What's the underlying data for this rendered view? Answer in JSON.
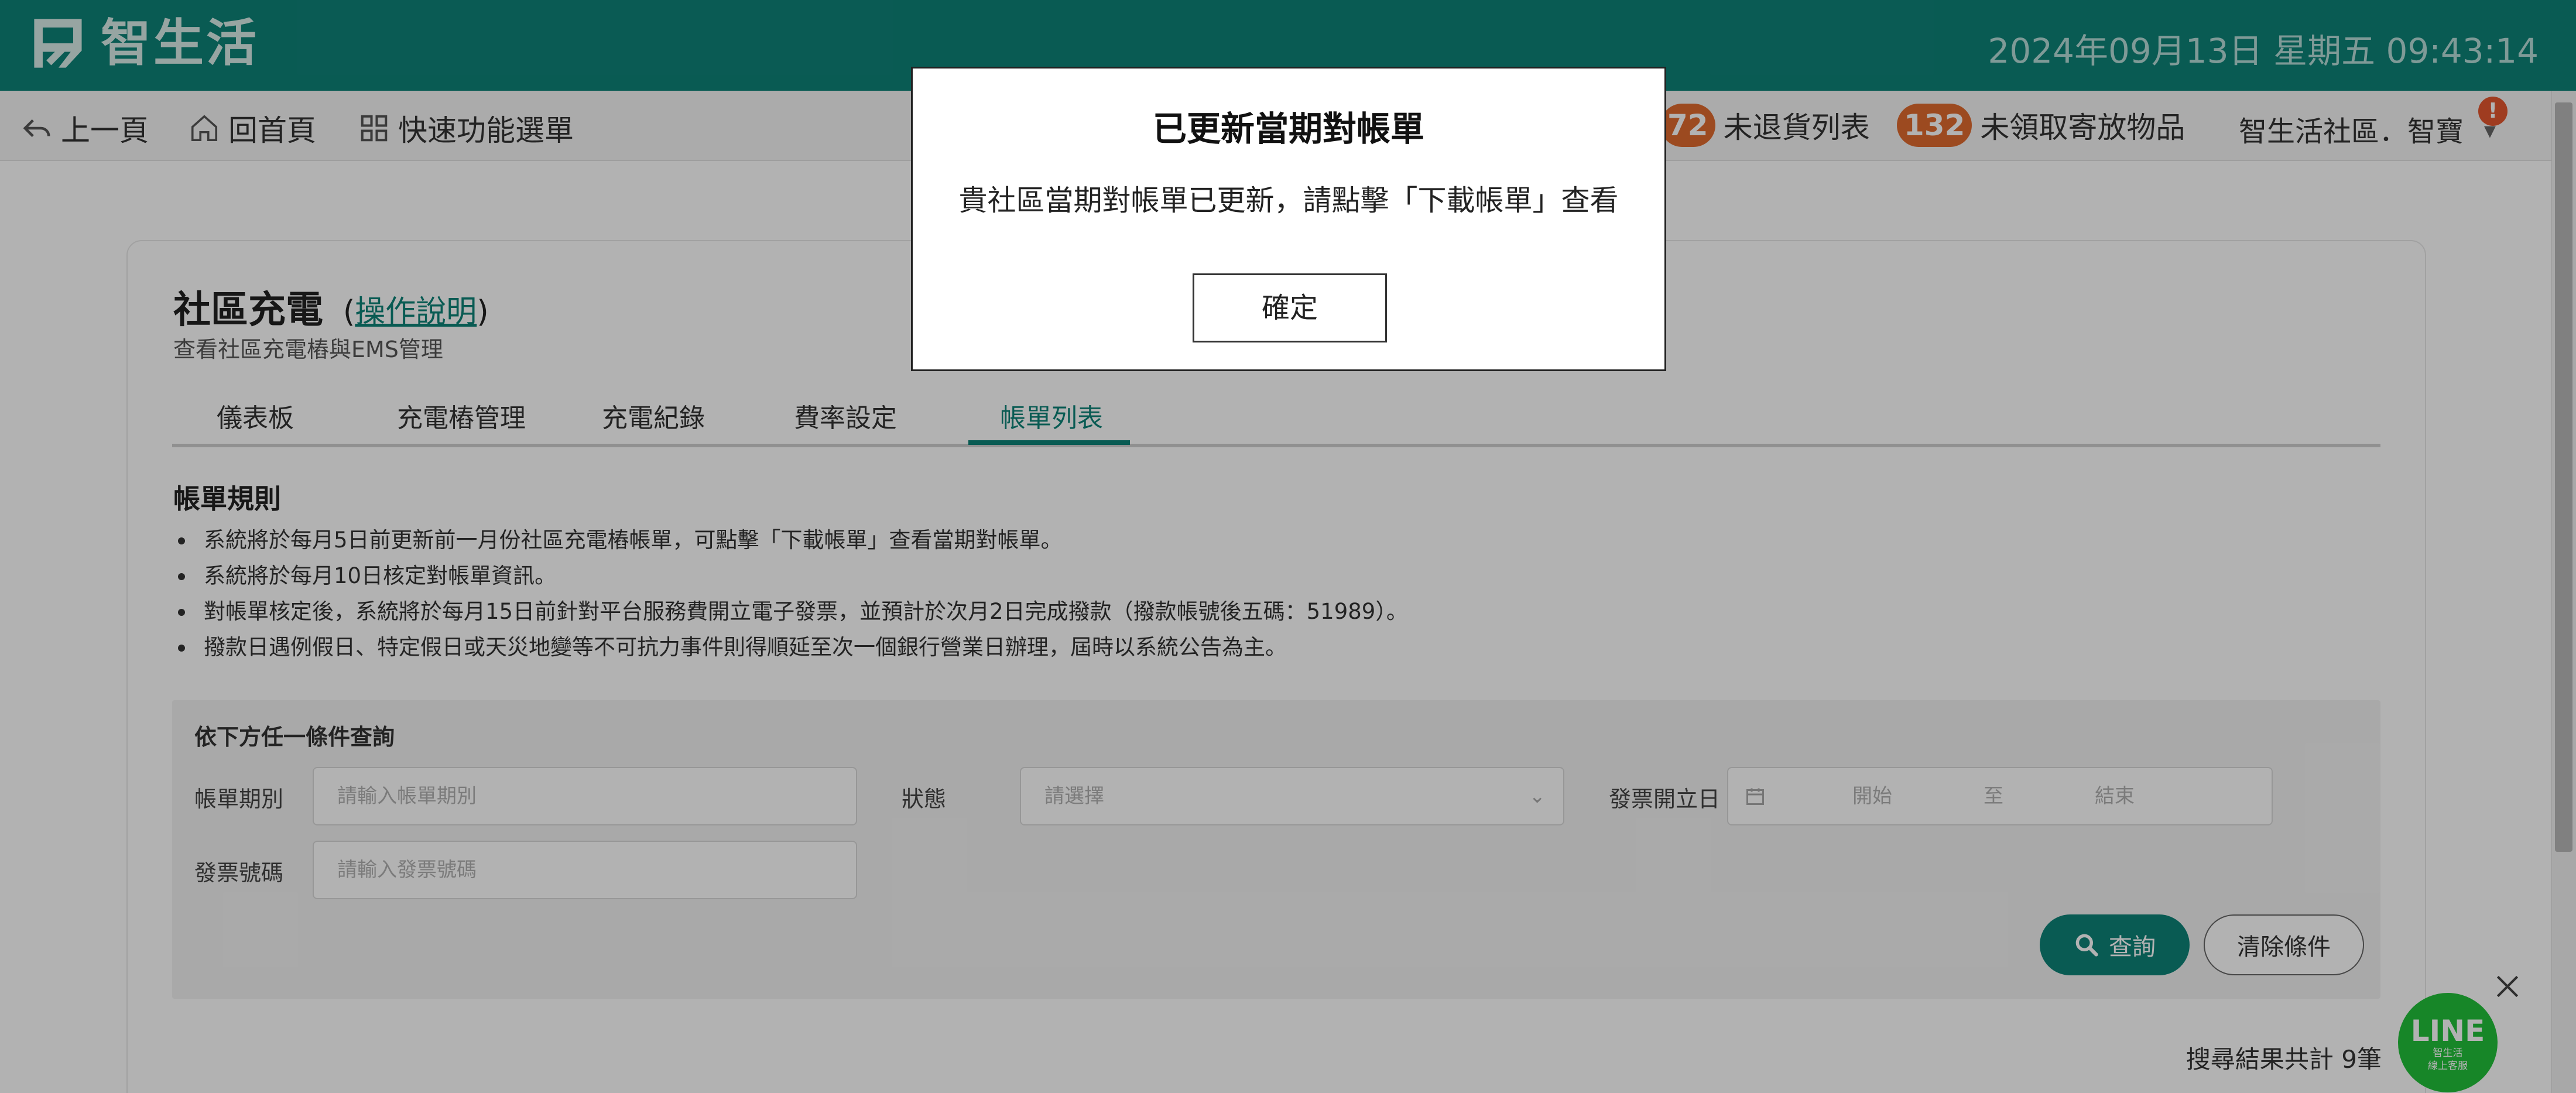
{
  "header": {
    "brand": "智生活",
    "datetime": "2024年09月13日 星期五 09:43:14"
  },
  "nav": {
    "back": "上一頁",
    "home": "回首頁",
    "quick_menu": "快速功能選單",
    "returns_count": "72",
    "returns_label": "未退貨列表",
    "parcels_count": "132",
    "parcels_label": "未領取寄放物品",
    "user": "智生活社區．智寶",
    "alert": "!"
  },
  "page": {
    "title": "社區充電",
    "help_open": "(",
    "help_link": "操作說明",
    "help_close": ")",
    "subtitle": "查看社區充電樁與EMS管理"
  },
  "tabs": [
    {
      "label": "儀表板",
      "active": false
    },
    {
      "label": "充電樁管理",
      "active": false
    },
    {
      "label": "充電紀錄",
      "active": false
    },
    {
      "label": "費率設定",
      "active": false
    },
    {
      "label": "帳單列表",
      "active": true
    }
  ],
  "rules": {
    "title": "帳單規則",
    "items": [
      "系統將於每月5日前更新前一月份社區充電樁帳單，可點擊「下載帳單」查看當期對帳單。",
      "系統將於每月10日核定對帳單資訊。",
      "對帳單核定後，系統將於每月15日前針對平台服務費開立電子發票，並預計於次月2日完成撥款（撥款帳號後五碼：51989）。",
      "撥款日遇例假日、特定假日或天災地變等不可抗力事件則得順延至次一個銀行營業日辦理，屆時以系統公告為主。"
    ]
  },
  "filter": {
    "title": "依下方任一條件查詢",
    "period_label": "帳單期別",
    "period_placeholder": "請輸入帳單期別",
    "status_label": "狀態",
    "status_placeholder": "請選擇",
    "invoice_date_label": "發票開立日",
    "date_start": "開始",
    "date_to": "至",
    "date_end": "結束",
    "invoice_no_label": "發票號碼",
    "invoice_no_placeholder": "請輸入發票號碼",
    "search_button": "查詢",
    "clear_button": "清除條件"
  },
  "results": {
    "count_text": "搜尋結果共計 9筆"
  },
  "line_widget": {
    "title": "LINE",
    "line1": "智生活",
    "line2": "線上客服"
  },
  "modal": {
    "title": "已更新當期對帳單",
    "message": "貴社區當期對帳單已更新，請點擊「下載帳單」查看",
    "confirm": "確定"
  },
  "colors": {
    "brand": "#0e8378",
    "badge": "#e06a2e",
    "line_green": "#22c13a"
  }
}
